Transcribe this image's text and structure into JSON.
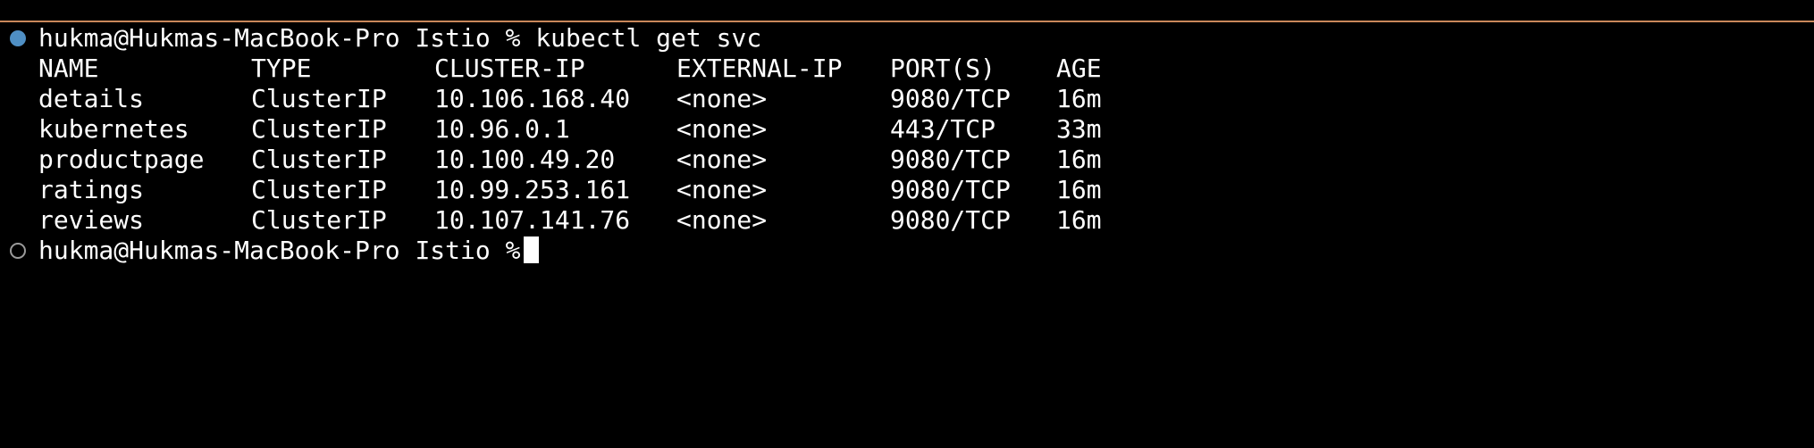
{
  "terminal": {
    "prompt_user_host": "hukma@Hukmas-MacBook-Pro",
    "prompt_dir": "Istio",
    "prompt_symbol": "%",
    "command": "kubectl get svc",
    "status_colors": {
      "completed_dot": "#4f8fc4",
      "pending_dot": "#9a9a9a",
      "top_border": "#c9875a"
    },
    "table": {
      "headers": [
        "NAME",
        "TYPE",
        "CLUSTER-IP",
        "EXTERNAL-IP",
        "PORT(S)",
        "AGE"
      ],
      "rows": [
        [
          "details",
          "ClusterIP",
          "10.106.168.40",
          "<none>",
          "9080/TCP",
          "16m"
        ],
        [
          "kubernetes",
          "ClusterIP",
          "10.96.0.1",
          "<none>",
          "443/TCP",
          "33m"
        ],
        [
          "productpage",
          "ClusterIP",
          "10.100.49.20",
          "<none>",
          "9080/TCP",
          "16m"
        ],
        [
          "ratings",
          "ClusterIP",
          "10.99.253.161",
          "<none>",
          "9080/TCP",
          "16m"
        ],
        [
          "reviews",
          "ClusterIP",
          "10.107.141.76",
          "<none>",
          "9080/TCP",
          "16m"
        ]
      ]
    }
  }
}
